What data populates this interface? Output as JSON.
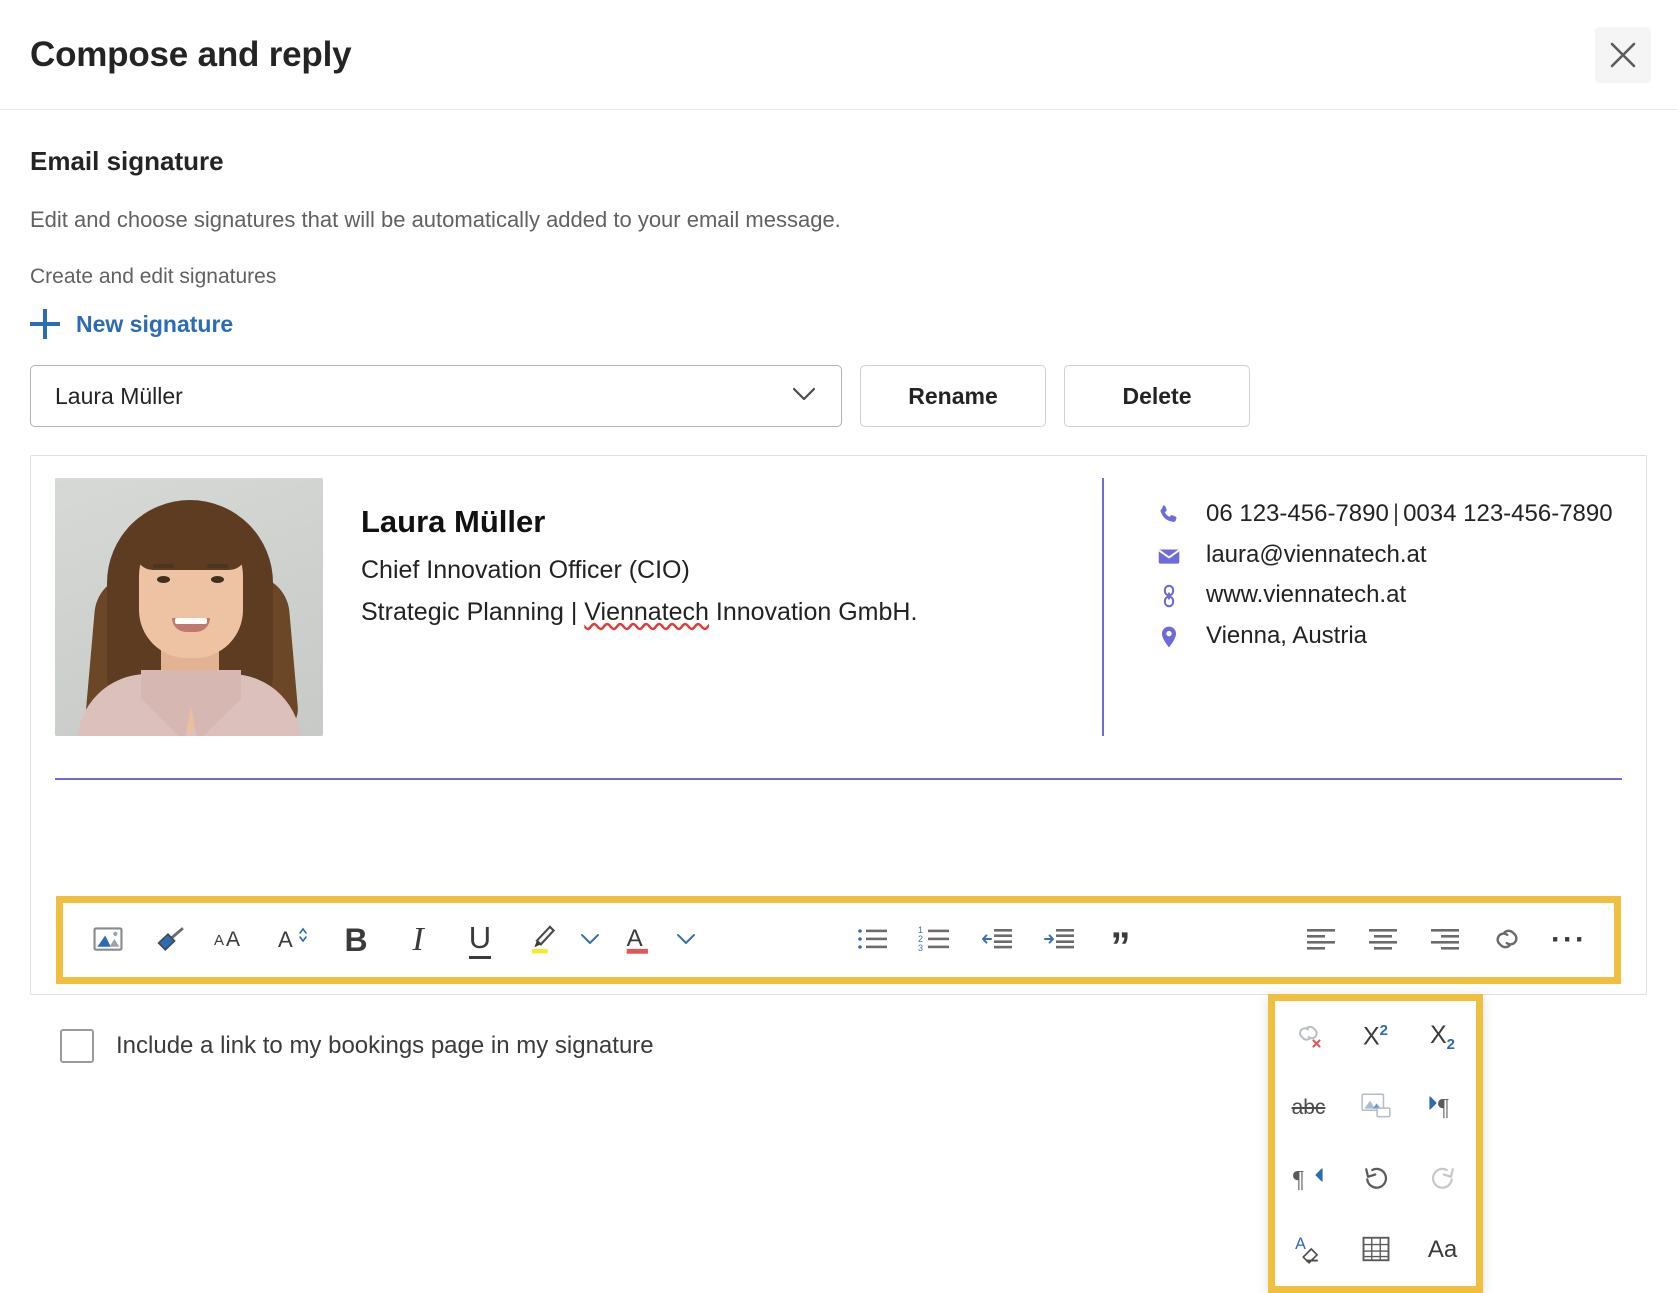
{
  "header": {
    "title": "Compose and reply",
    "close_icon": "close-icon"
  },
  "section": {
    "title": "Email signature",
    "description": "Edit and choose signatures that will be automatically added to your email message.",
    "sub_label": "Create and edit signatures",
    "new_signature_label": "New signature"
  },
  "signature_select": {
    "value": "Laura Müller",
    "chevron_icon": "chevron-down-icon",
    "rename_label": "Rename",
    "delete_label": "Delete"
  },
  "signature": {
    "photo_alt": "Portrait of Laura Müller",
    "name": "Laura Müller",
    "title_line": "Chief Innovation Officer (CIO)",
    "company_line_prefix": "Strategic Planning | ",
    "company_misspelled": "Viennatech",
    "company_line_suffix": " Innovation GmbH.",
    "contacts": [
      {
        "icon": "phone-icon",
        "value": "06 123-456-7890",
        "separator": "|",
        "value2": "0034 123-456-7890"
      },
      {
        "icon": "envelope-icon",
        "value": "laura@viennatech.at"
      },
      {
        "icon": "link-icon",
        "value": "www.viennatech.at"
      },
      {
        "icon": "location-pin-icon",
        "value": "Vienna, Austria"
      }
    ]
  },
  "toolbar": {
    "items": [
      {
        "name": "insert-picture-button",
        "icon": "picture-icon"
      },
      {
        "name": "format-painter-button",
        "icon": "paintbrush-icon"
      },
      {
        "name": "font-size-button",
        "icon": "font-size-aa-icon"
      },
      {
        "name": "font-size-stepper-button",
        "icon": "font-size-a-stepper-icon"
      },
      {
        "name": "bold-button",
        "icon": "bold-icon",
        "label": "B"
      },
      {
        "name": "italic-button",
        "icon": "italic-icon",
        "label": "I"
      },
      {
        "name": "underline-button",
        "icon": "underline-icon",
        "label": "U"
      },
      {
        "name": "highlight-button",
        "icon": "highlighter-icon"
      },
      {
        "name": "highlight-color-chevron",
        "icon": "chevron-down-icon"
      },
      {
        "name": "font-color-button",
        "icon": "font-color-a-icon"
      },
      {
        "name": "font-color-chevron",
        "icon": "chevron-down-icon"
      },
      {
        "name": "bulleted-list-button",
        "icon": "bulleted-list-icon"
      },
      {
        "name": "numbered-list-button",
        "icon": "numbered-list-icon"
      },
      {
        "name": "decrease-indent-button",
        "icon": "decrease-indent-icon"
      },
      {
        "name": "increase-indent-button",
        "icon": "increase-indent-icon"
      },
      {
        "name": "quote-button",
        "icon": "quote-icon",
        "label": "”"
      },
      {
        "name": "align-left-button",
        "icon": "align-left-icon"
      },
      {
        "name": "align-center-button",
        "icon": "align-center-icon"
      },
      {
        "name": "align-right-button",
        "icon": "align-right-icon"
      },
      {
        "name": "insert-link-button",
        "icon": "link-icon"
      },
      {
        "name": "more-options-button",
        "icon": "ellipsis-icon",
        "label": "···"
      }
    ],
    "highlight_color": "#f0bf3f"
  },
  "popup_menu": {
    "highlight_color": "#f0bf3f",
    "items": [
      {
        "name": "remove-link-button",
        "icon": "remove-link-icon",
        "label": "",
        "disabled": false
      },
      {
        "name": "superscript-button",
        "icon": "superscript-icon",
        "label": "X",
        "sup": "2",
        "disabled": false
      },
      {
        "name": "subscript-button",
        "icon": "subscript-icon",
        "label": "X",
        "sub": "2",
        "disabled": false
      },
      {
        "name": "strikethrough-button",
        "icon": "strikethrough-icon",
        "label": "abc",
        "disabled": false
      },
      {
        "name": "insert-inline-picture-button",
        "icon": "picture-insert-icon",
        "label": "",
        "disabled": false
      },
      {
        "name": "left-to-right-button",
        "icon": "ltr-paragraph-icon",
        "label": "",
        "disabled": false
      },
      {
        "name": "right-to-left-button",
        "icon": "rtl-paragraph-icon",
        "label": "",
        "disabled": false
      },
      {
        "name": "undo-button",
        "icon": "undo-icon",
        "label": "",
        "disabled": false
      },
      {
        "name": "redo-button",
        "icon": "redo-icon",
        "label": "",
        "disabled": true
      },
      {
        "name": "clear-formatting-button",
        "icon": "clear-formatting-icon",
        "label": "",
        "disabled": false
      },
      {
        "name": "insert-table-button",
        "icon": "table-icon",
        "label": "",
        "disabled": false
      },
      {
        "name": "change-case-button",
        "icon": "change-case-icon",
        "label": "Aa",
        "disabled": false
      }
    ]
  },
  "bookings_checkbox": {
    "label": "Include a link to my bookings page in my signature",
    "checked": false
  },
  "colors": {
    "accent_blue": "#2b6cb5",
    "signature_purple": "#6d6bd8",
    "highlight_yellow": "#f0bf3f",
    "spellcheck_red": "#e03b3b"
  }
}
